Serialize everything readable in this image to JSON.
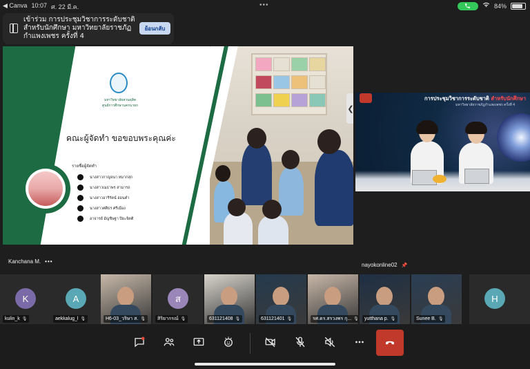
{
  "status_bar": {
    "back_app": "◀ Canva",
    "time": "10:07",
    "date": "ศ. 22 มี.ค.",
    "battery": "84%",
    "battery_level": 0.84,
    "inner_battery": "75%"
  },
  "banner": {
    "text": "เข้าร่วม การประชุมวิชาการระดับชาติ สำหรับนักศึกษา มหาวิทยาลัยราชภัฏกำแพงเพชร ครั้งที่ 4",
    "return_button": "ย้อนกลับ"
  },
  "slide": {
    "logo_line1": "มหาวิทยาลัยสวนดุสิต",
    "logo_line2": "ศูนย์การศึกษานครนายก",
    "heading": "คณะผู้จัดทำ  ขอขอบพระคุณค่ะ",
    "list_title": "รายชื่อผู้จัดทำ",
    "members": [
      "นางสาวกาญจนา หมากสุก",
      "นางสาวเมธาพร สามารถ",
      "นางสาวอารีรัตน์ อ่อนคำ",
      "นางสาวศศิธร ศรีเมือง",
      "อาจารย์ อัญชิษฐา ปิยะจิตติ"
    ]
  },
  "main_presenter_label": "Kanchana M.",
  "speaker": {
    "title_prefix": "การประชุมวิชาการระดับชาติ ",
    "title_highlight": "สำหรับนักศึกษา",
    "subtitle": "มหาวิทยาลัยราชภัฏกำแพงเพชร ครั้งที่ 4",
    "name": "nayokonline02"
  },
  "participants": [
    {
      "name": "kulin_k",
      "initial": "K",
      "color": "#7b6aa8",
      "type": "avatar"
    },
    {
      "name": "aekkalug_l",
      "initial": "A",
      "color": "#5aa7b5",
      "type": "avatar"
    },
    {
      "name": "H6-03_วริษา ส.",
      "initial": "",
      "color": "#c7b8a8",
      "type": "video"
    },
    {
      "name": "สิริยากรณ์",
      "initial": "ส",
      "color": "#9a86b8",
      "type": "avatar"
    },
    {
      "name": "631121408",
      "initial": "",
      "color": "#d8d4cc",
      "type": "video"
    },
    {
      "name": "631121401",
      "initial": "",
      "color": "#243a4e",
      "type": "video"
    },
    {
      "name": "รศ.ดร.สรวงพร กุ...",
      "initial": "",
      "color": "#c8b7a8",
      "type": "video"
    },
    {
      "name": "yutthana p.",
      "initial": "",
      "color": "#1e2f44",
      "type": "video"
    },
    {
      "name": "Sunee B.",
      "initial": "",
      "color": "#2a3e55",
      "type": "video"
    },
    {
      "name": "",
      "initial": "H",
      "color": "#5aa7b5",
      "type": "avatar"
    }
  ],
  "toolbar": {
    "buttons": [
      "chat",
      "participants",
      "share-screen",
      "reactions",
      "camera-off",
      "mic-off",
      "speaker-off",
      "more"
    ],
    "hangup": "end-call"
  },
  "colors": {
    "slide_green": "#1c6b43",
    "hangup_red": "#c0392b",
    "active_outline": "#6d62d6"
  }
}
